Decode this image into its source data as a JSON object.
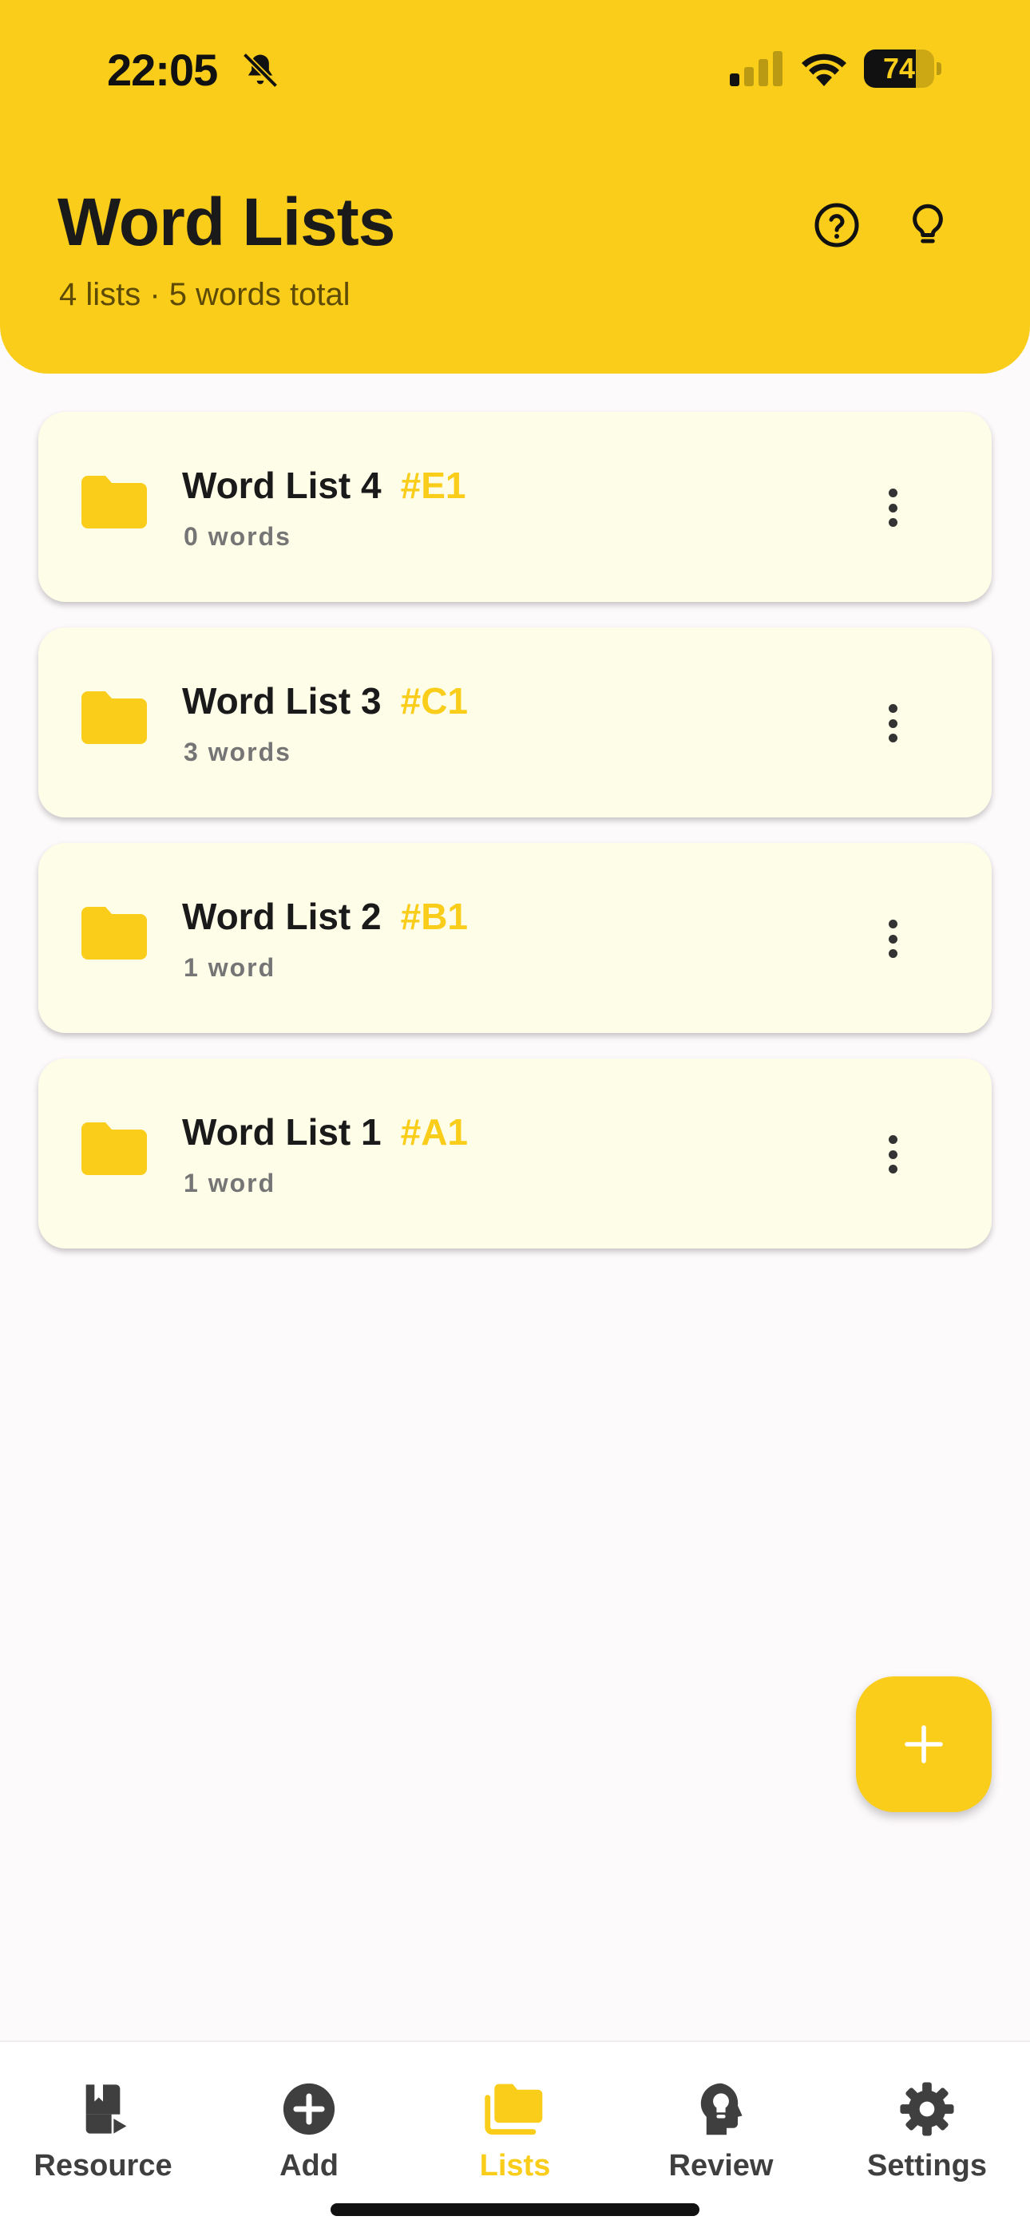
{
  "status_bar": {
    "time": "22:05",
    "battery": "74",
    "battery_level": 0.74
  },
  "header": {
    "title": "Word Lists",
    "subtitle": "4 lists · 5 words total",
    "help_icon": "help-circle-icon",
    "tip_icon": "lightbulb-icon"
  },
  "lists": [
    {
      "name": "Word List 4",
      "tag": "#E1",
      "count": "0 words"
    },
    {
      "name": "Word List 3",
      "tag": "#C1",
      "count": "3 words"
    },
    {
      "name": "Word List 2",
      "tag": "#B1",
      "count": "1 word"
    },
    {
      "name": "Word List 1",
      "tag": "#A1",
      "count": "1 word"
    }
  ],
  "fab": {
    "icon": "plus-icon"
  },
  "nav": [
    {
      "label": "Resource",
      "icon": "resource-icon",
      "active": false
    },
    {
      "label": "Add",
      "icon": "add-circle-icon",
      "active": false
    },
    {
      "label": "Lists",
      "icon": "folders-icon",
      "active": true
    },
    {
      "label": "Review",
      "icon": "brain-icon",
      "active": false
    },
    {
      "label": "Settings",
      "icon": "gear-icon",
      "active": false
    }
  ],
  "colors": {
    "accent": "#F9CD1A",
    "card_bg": "#FEFDE8",
    "page_bg": "#FDFAFC",
    "nav_inactive": "#3f3f3f"
  }
}
